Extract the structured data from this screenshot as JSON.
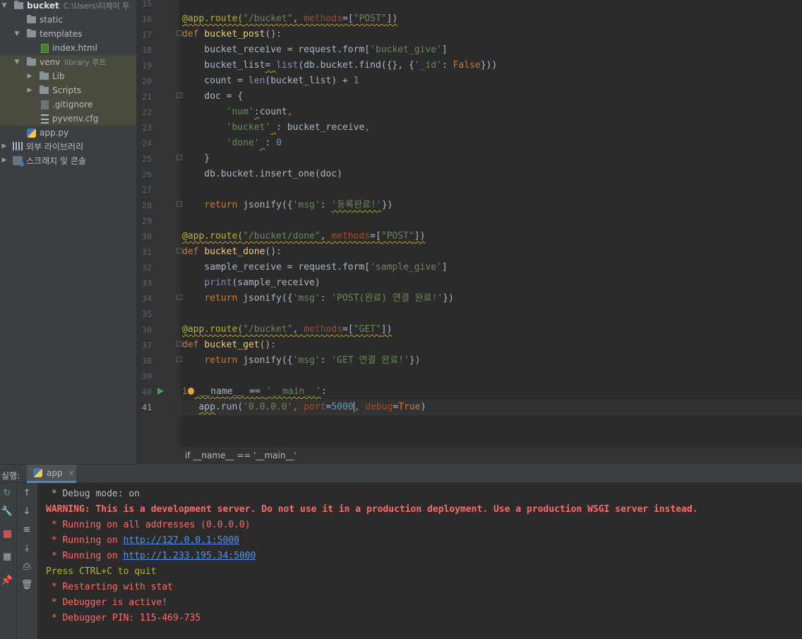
{
  "project_tree": {
    "root_name": "bucket",
    "root_path": "C:\\Users\\티제이 투",
    "items": [
      {
        "label": "static"
      },
      {
        "label": "templates"
      },
      {
        "label": "index.html"
      },
      {
        "label": "venv",
        "suffix": "library 루트"
      },
      {
        "label": "Lib"
      },
      {
        "label": "Scripts"
      },
      {
        "label": ".gitignore"
      },
      {
        "label": "pyvenv.cfg"
      },
      {
        "label": "app.py"
      },
      {
        "label": "외부 라이브러리"
      },
      {
        "label": "스크래치 및 콘솔"
      }
    ]
  },
  "editor": {
    "line_numbers": [
      "15",
      "16",
      "17",
      "18",
      "19",
      "20",
      "21",
      "22",
      "23",
      "24",
      "25",
      "26",
      "27",
      "28",
      "29",
      "30",
      "31",
      "32",
      "33",
      "34",
      "35",
      "36",
      "37",
      "38",
      "39",
      "40",
      "41"
    ],
    "code": {
      "l16": {
        "a": "@app.route(",
        "b": "\"/bucket\"",
        "c": ", ",
        "d": "methods",
        "e": "=[",
        "f": "\"POST\"",
        "g": "])"
      },
      "l17": {
        "a": "def ",
        "b": "bucket_post",
        "c": "():"
      },
      "l18": {
        "a": "    bucket_receive = request.form[",
        "b": "'bucket_give'",
        "c": "]"
      },
      "l19": {
        "a": "    bucket_list",
        "b": "= ",
        "c": "list",
        "d": "(db.bucket.find({}, {",
        "e": "'_id'",
        "f": ": ",
        "g": "False",
        "h": "}))"
      },
      "l20": {
        "a": "    count = ",
        "b": "len",
        "c": "(bucket_list) + ",
        "d": "1"
      },
      "l21": {
        "a": "    doc = {"
      },
      "l22": {
        "a": "        ",
        "b": "'num'",
        "c": ":",
        "d": "count",
        "e": ","
      },
      "l23": {
        "a": "        ",
        "b": "'bucket'",
        "c": " ",
        "d": ": bucket_receive",
        "e": ","
      },
      "l24": {
        "a": "        ",
        "b": "'done'",
        "c": " ",
        "d": ": ",
        "e": "0"
      },
      "l25": {
        "a": "    }"
      },
      "l26": {
        "a": "    db.bucket.insert_one(doc)"
      },
      "l28": {
        "a": "    ",
        "b": "return ",
        "c": "jsonify({",
        "d": "'msg'",
        "e": ": ",
        "f": "'등록완료!'",
        "g": "})"
      },
      "l30": {
        "a": "@app.route(",
        "b": "\"/bucket/done\"",
        "c": ", ",
        "d": "methods",
        "e": "=[",
        "f": "\"POST\"",
        "g": "])"
      },
      "l31": {
        "a": "def ",
        "b": "bucket_done",
        "c": "():"
      },
      "l32": {
        "a": "    sample_receive = request.form[",
        "b": "'sample_give'",
        "c": "]"
      },
      "l33": {
        "a": "    ",
        "b": "print",
        "c": "(sample_receive)"
      },
      "l34": {
        "a": "    ",
        "b": "return ",
        "c": "jsonify({",
        "d": "'msg'",
        "e": ": ",
        "f": "'POST(완료) 연결 완료!'",
        "g": "})"
      },
      "l36": {
        "a": "@app.route(",
        "b": "\"/bucket\"",
        "c": ", ",
        "d": "methods",
        "e": "=[",
        "f": "\"GET\"",
        "g": "])"
      },
      "l37": {
        "a": "def ",
        "b": "bucket_get",
        "c": "():"
      },
      "l38": {
        "a": "    ",
        "b": "return ",
        "c": "jsonify({",
        "d": "'msg'",
        "e": ": ",
        "f": "'GET 연결 완료!'",
        "g": "})"
      },
      "l40": {
        "a": "i",
        "b": " __name__ == ",
        "c": "'__main__'",
        "d": ":"
      },
      "l41": {
        "a": "   ",
        "b": "app",
        "c": ".run(",
        "d": "'0.0.0.0'",
        "e": ", ",
        "f": "port",
        "g": "=",
        "h": "5000",
        "i": ", ",
        "j": "debug",
        "k": "=",
        "l": "True",
        "m": ")"
      }
    }
  },
  "breadcrumb": {
    "text": "if __name__ == '__main__'"
  },
  "run_panel": {
    "label": "실행:",
    "tab_label": "app",
    "tab_close": "×",
    "console_lines": [
      {
        "text": " * Debug mode: on",
        "style": "white"
      },
      {
        "text": "WARNING: This is a development server. Do not use it in a production deployment. Use a production WSGI server instead.",
        "style": "redb"
      },
      {
        "text": " * Running on all addresses (0.0.0.0)",
        "style": "red"
      },
      {
        "prefix": " * Running on ",
        "link": "http://127.0.0.1:5000",
        "style": "red"
      },
      {
        "prefix": " * Running on ",
        "link": "http://1.233.195.34:5000",
        "style": "red"
      },
      {
        "text": "Press CTRL+C to quit",
        "style": "yellow"
      },
      {
        "text": " * Restarting with stat",
        "style": "red"
      },
      {
        "text": " * Debugger is active!",
        "style": "red"
      },
      {
        "text": " * Debugger PIN: 115-469-735",
        "style": "red"
      }
    ]
  },
  "colors": {
    "keyword": "#cc7832",
    "string": "#6a8759",
    "decorator": "#bbb529",
    "function": "#ffc66d",
    "number": "#6897bb",
    "console_error": "#ff6b68",
    "console_link": "#5394ec"
  }
}
